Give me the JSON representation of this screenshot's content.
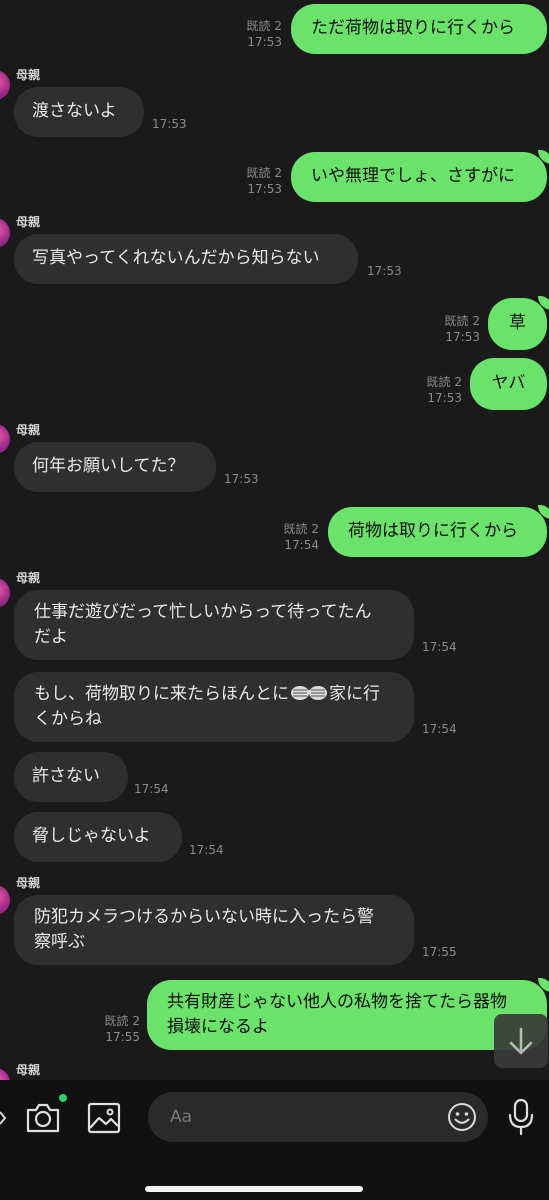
{
  "colors": {
    "background": "#1a1a1a",
    "incoming_bubble": "#2f2f2f",
    "outgoing_bubble": "#6be36b",
    "online_dot": "#2fd16b"
  },
  "messages": [
    {
      "side": "out",
      "read": "既読 2",
      "time": "17:53",
      "text": "ただ荷物は取りに行くから"
    },
    {
      "side": "in",
      "sender": "母親",
      "time": "17:53",
      "text": "渡さないよ"
    },
    {
      "side": "out",
      "read": "既読 2",
      "time": "17:53",
      "text": "いや無理でしょ、さすがに"
    },
    {
      "side": "in",
      "sender": "母親",
      "time": "17:53",
      "text": "写真やってくれないんだから知らない"
    },
    {
      "side": "out",
      "read": "既読 2",
      "time": "17:53",
      "text": "草"
    },
    {
      "side": "out",
      "read": "既読 2",
      "time": "17:53",
      "text": "ヤバ"
    },
    {
      "side": "in",
      "sender": "母親",
      "time": "17:53",
      "text": "何年お願いしてた？"
    },
    {
      "side": "out",
      "read": "既読 2",
      "time": "17:54",
      "text": "荷物は取りに行くから"
    },
    {
      "side": "in",
      "sender": "母親",
      "time": "17:54",
      "line1": "仕事だ遊びだって忙しいからって待ってたん",
      "line2": "だよ"
    },
    {
      "side": "in",
      "time": "17:54",
      "line1a": "もし、荷物取りに来たらほんとに",
      "line1b": "家に行",
      "line2": "くからね"
    },
    {
      "side": "in",
      "time": "17:54",
      "text": "許さない"
    },
    {
      "side": "in",
      "time": "17:54",
      "text": "脅しじゃないよ"
    },
    {
      "side": "in",
      "sender": "母親",
      "time": "17:55",
      "line1": "防犯カメラつけるからいない時に入ったら警",
      "line2": "察呼ぶ"
    },
    {
      "side": "out",
      "read": "既読 2",
      "time": "17:55",
      "line1": "共有財産じゃない他人の私物を捨てたら器物",
      "line2": "損壊になるよ"
    },
    {
      "side": "in",
      "sender": "母親"
    }
  ],
  "composer": {
    "placeholder": "Aa",
    "camera_icon": "camera-icon",
    "image_icon": "image-icon",
    "emoji_icon": "emoji-icon",
    "mic_icon": "mic-icon"
  },
  "scroll_button_icon": "arrow-down-icon"
}
